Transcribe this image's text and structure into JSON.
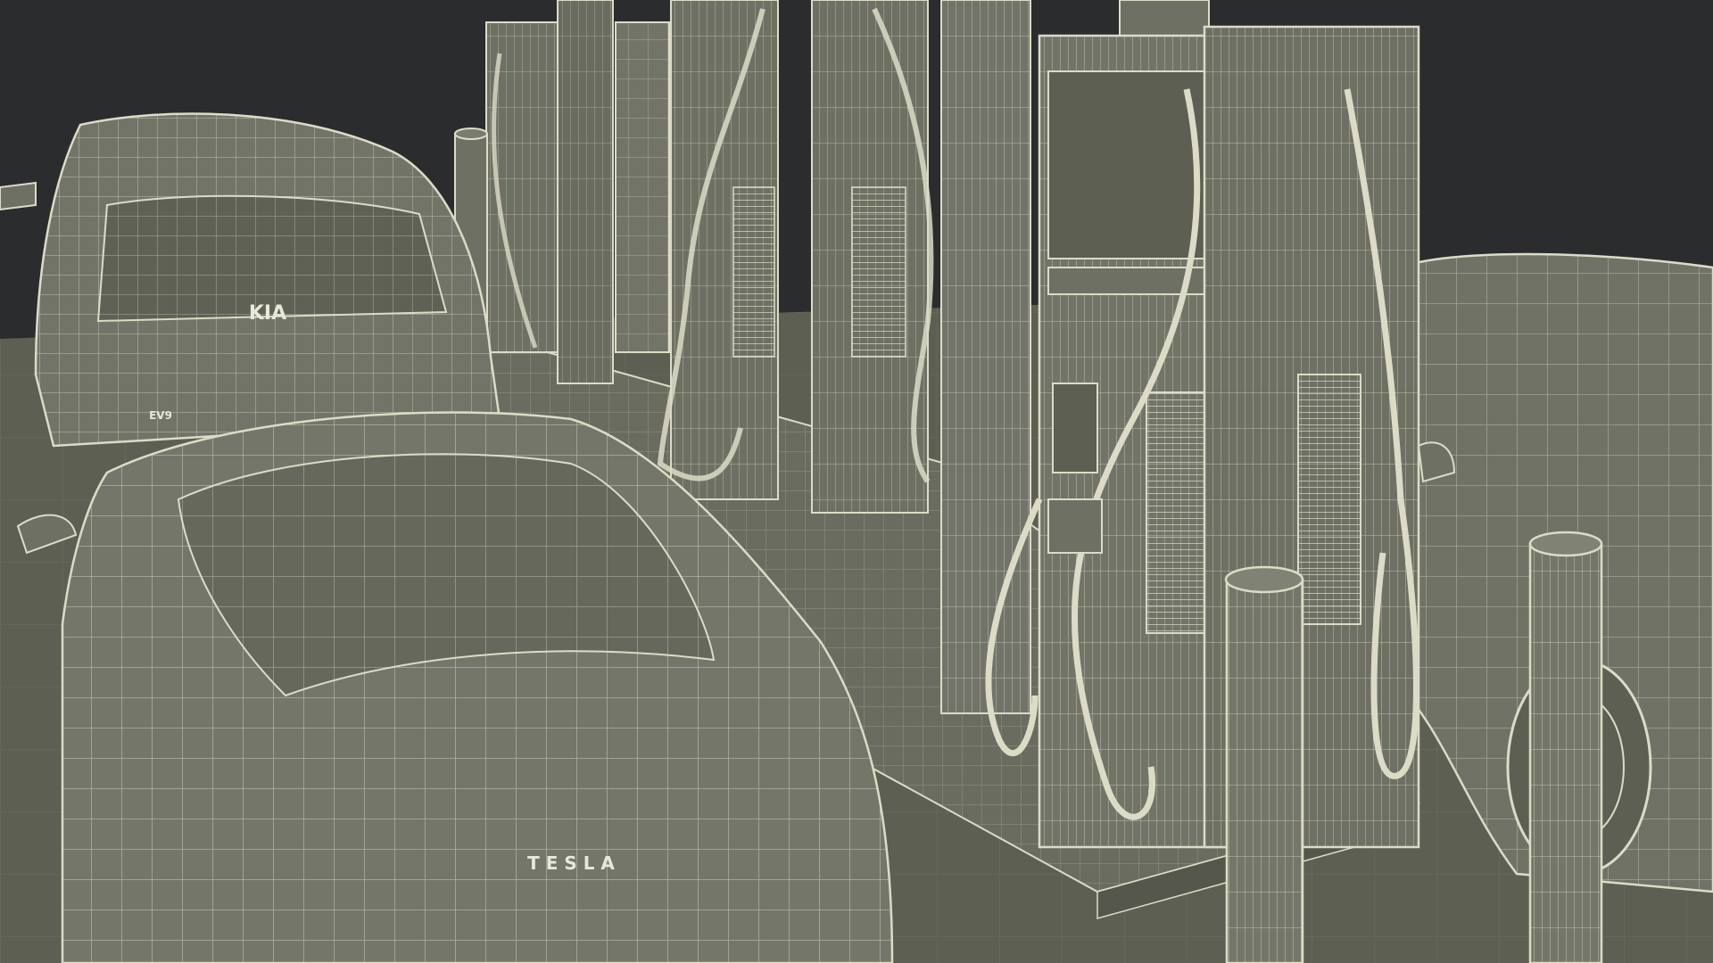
{
  "scene": {
    "background_color": "#2b2c2e",
    "ground_color": "#5d5f52",
    "surface_color": "#6e7064",
    "wire_color": "#dcdcc6",
    "dark_wire_color": "#3e4038"
  },
  "brands": {
    "rear_car_logo": "KIA",
    "rear_car_badge": "EV9",
    "front_car_logo": "T E S L A"
  }
}
